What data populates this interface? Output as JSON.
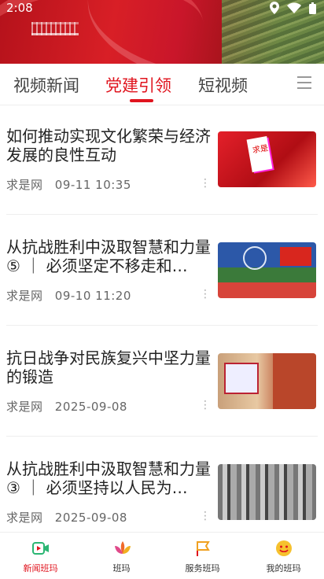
{
  "status_bar": {
    "time": "2:08"
  },
  "tabs": [
    {
      "label": "视频新闻"
    },
    {
      "label": "党建引领"
    },
    {
      "label": "短视频"
    }
  ],
  "active_tab": "党建引领",
  "articles": [
    {
      "title": "如何推动实现文化繁荣与经济发展的良性互动",
      "source": "求是网",
      "time": "09-11  10:35",
      "thumb": "red-book-cover"
    },
    {
      "title": "从抗战胜利中汲取智慧和力量⑤ ｜ 必须坚定不移走和…",
      "source": "求是网",
      "time": "09-10  11:20",
      "thumb": "peacekeeping-soldiers"
    },
    {
      "title": "抗日战争对民族复兴中坚力量的锻造",
      "source": "求是网",
      "time": "2025-09-08",
      "thumb": "museum-exhibition"
    },
    {
      "title": "从抗战胜利中汲取智慧和力量③ ｜ 必须坚持以人民为…",
      "source": "求是网",
      "time": "2025-09-08",
      "thumb": "historic-soldiers"
    }
  ],
  "bottom_nav": [
    {
      "label": "新闻班玛",
      "icon": "video-icon"
    },
    {
      "label": "班玛",
      "icon": "lotus-icon"
    },
    {
      "label": "服务班玛",
      "icon": "flag-icon"
    },
    {
      "label": "我的班玛",
      "icon": "smiley-icon"
    }
  ],
  "colors": {
    "accent": "#e0141e"
  }
}
